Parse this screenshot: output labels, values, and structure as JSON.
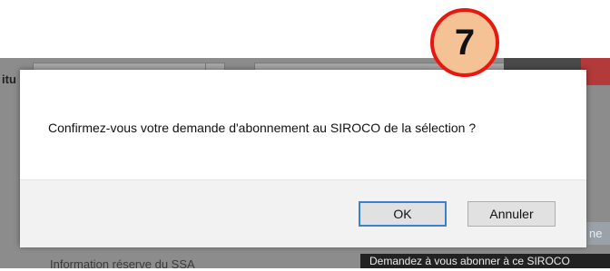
{
  "background": {
    "left_label": "itu",
    "right_edge_text": "ne",
    "bottom_left_text": "Information réserve du SSA",
    "bottom_right_tooltip": "Demandez à vous abonner à ce SIROCO"
  },
  "dialog": {
    "message": "Confirmez-vous votre demande d'abonnement au SIROCO de la sélection ?",
    "ok_label": "OK",
    "cancel_label": "Annuler"
  },
  "annotation": {
    "step_number": "7"
  },
  "colors": {
    "marker_border": "#e8170f",
    "marker_fill": "#f5c296",
    "ok_focus": "#3c7fd1"
  }
}
